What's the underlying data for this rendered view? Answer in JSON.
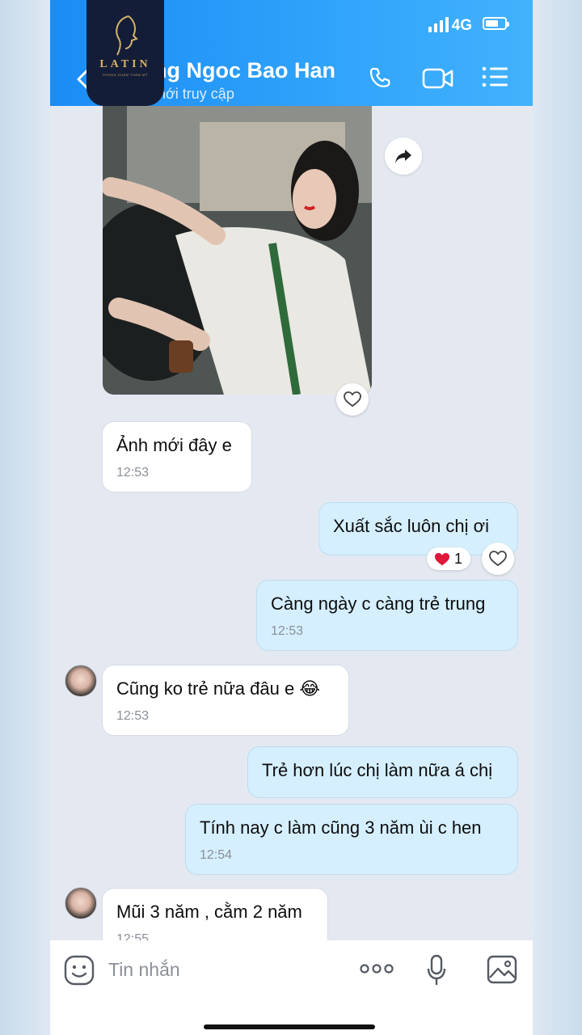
{
  "status": {
    "network": "4G"
  },
  "header": {
    "contact_name": "ng Ngoc Bao Han",
    "last_seen": "mới truy cập"
  },
  "logo": {
    "text": "LATIN",
    "subtitle": "PHÒNG KHÁM THẨM MỸ"
  },
  "messages": [
    {
      "id": "m1",
      "side": "in",
      "text": "Ảnh mới đây e",
      "time": "12:53"
    },
    {
      "id": "m2",
      "side": "out",
      "text": "Xuất sắc luôn chị ơi",
      "reaction_count": "1"
    },
    {
      "id": "m3",
      "side": "out",
      "text": "Càng ngày c càng trẻ trung",
      "time": "12:53"
    },
    {
      "id": "m4",
      "side": "in",
      "text": "Cũng ko trẻ nữa đâu e",
      "emoji": "😂",
      "time": "12:53"
    },
    {
      "id": "m5",
      "side": "out",
      "text": "Trẻ hơn lúc chị làm nữa á chị"
    },
    {
      "id": "m6",
      "side": "out",
      "text": "Tính nay c làm cũng 3 năm ùi c hen",
      "time": "12:54"
    },
    {
      "id": "m7",
      "side": "in",
      "text": "Mũi 3 năm , cằm 2 năm",
      "time": "12:55"
    }
  ],
  "input": {
    "placeholder": "Tin nhắn"
  },
  "colors": {
    "header": "#1a8cf5",
    "outgoing_bubble": "#d5efff",
    "incoming_bubble": "#ffffff",
    "heart": "#e0163a"
  }
}
